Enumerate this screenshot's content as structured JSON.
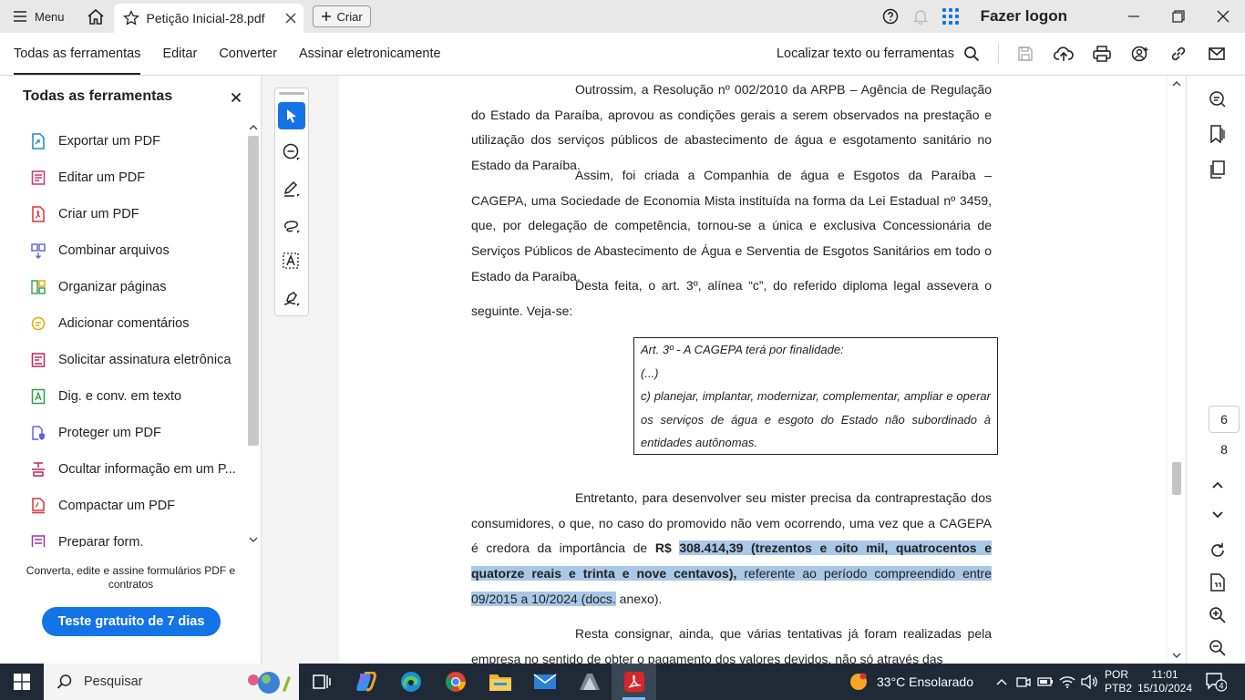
{
  "titlebar": {
    "menu_label": "Menu",
    "tab_title": "Petição Inicial-28.pdf",
    "create_label": "Criar",
    "logon_label": "Fazer logon"
  },
  "toolbar": {
    "tabs": [
      "Todas as ferramentas",
      "Editar",
      "Converter",
      "Assinar eletronicamente"
    ],
    "search_label": "Localizar texto ou ferramentas"
  },
  "left_panel": {
    "title": "Todas as ferramentas",
    "items": [
      {
        "label": "Exportar um PDF",
        "icon": "export-pdf-icon",
        "color": "#1e88c8"
      },
      {
        "label": "Editar um PDF",
        "icon": "edit-pdf-icon",
        "color": "#d6336c"
      },
      {
        "label": "Criar um PDF",
        "icon": "create-pdf-icon",
        "color": "#e03131"
      },
      {
        "label": "Combinar arquivos",
        "icon": "combine-files-icon",
        "color": "#5c5fd6"
      },
      {
        "label": "Organizar páginas",
        "icon": "organize-pages-icon",
        "color": "#2f9e44"
      },
      {
        "label": "Adicionar comentários",
        "icon": "comment-icon",
        "color": "#e0a800"
      },
      {
        "label": "Solicitar assinatura eletrônica",
        "icon": "request-signature-icon",
        "color": "#c2255c"
      },
      {
        "label": "Dig. e conv. em texto",
        "icon": "scan-ocr-icon",
        "color": "#2f9e44"
      },
      {
        "label": "Proteger um PDF",
        "icon": "protect-pdf-icon",
        "color": "#5c5fd6"
      },
      {
        "label": "Ocultar informação em um P...",
        "icon": "redact-icon",
        "color": "#c2255c"
      },
      {
        "label": "Compactar um PDF",
        "icon": "compress-pdf-icon",
        "color": "#e03131"
      },
      {
        "label": "Preparar form.",
        "icon": "prepare-form-icon",
        "color": "#9c36b5"
      }
    ],
    "promo_text": "Converta, edite e assine formulários PDF e contratos",
    "cta_label": "Teste gratuito de 7 dias"
  },
  "document": {
    "p1": "Outrossim, a Resolução nº 002/2010 da ARPB – Agência de Regulação do Estado da Paraíba, aprovou as condições gerais a serem observados na prestação e utilização dos serviços públicos de abastecimento de água e esgotamento sanitário no Estado da Paraíba.",
    "p2": "Assim, foi criada a Companhia de água e Esgotos da Paraíba – CAGEPA, uma Sociedade de Economia Mista instituída na forma da Lei Estadual nº 3459, que, por delegação de competência, tornou-se a única e exclusiva Concessionária de Serviços Públicos de Abastecimento de Água e Serventia de Esgotos Sanitários em todo o Estado da Paraíba.",
    "p3": "Desta feita, o art. 3º, alínea “c”, do referido diploma legal assevera o seguinte. Veja-se:",
    "quote_l1": "Art. 3º - A CAGEPA terá por finalidade:",
    "quote_l2": "(...)",
    "quote_l3": "c) planejar, implantar, modernizar, complementar, ampliar e operar os serviços de água e esgoto do Estado não subordinado à entidades autônomas.",
    "p4_a": "Entretanto, para desenvolver seu mister precisa da contraprestação dos consumidores, o que, no caso do promovido não vem ocorrendo, uma vez que a CAGEPA é credora da importância de ",
    "p4_b": "R$ ",
    "p4_c": "308.414,39 (trezentos e oito mil, quatrocentos e quatorze reais e trinta e nove centavos),",
    "p4_d": " referente ao período compreendido entre 09/2015 a 10/2024 (docs.",
    "p4_e": " anexo).",
    "p5": "Resta consignar, ainda, que várias tentativas já foram realizadas pela empresa no sentido de obter o pagamento dos valores devidos, não só através das"
  },
  "page_nav": {
    "current": "6",
    "total": "8"
  },
  "taskbar": {
    "search_placeholder": "Pesquisar",
    "weather": "33°C Ensolarado",
    "lang_1": "POR",
    "lang_2": "PTB2",
    "time": "11:01",
    "date": "15/10/2024",
    "notifications": "4"
  },
  "colors": {
    "accent": "#1473e6",
    "selection": "#a8c8e8",
    "taskbar": "#1f2a36"
  }
}
